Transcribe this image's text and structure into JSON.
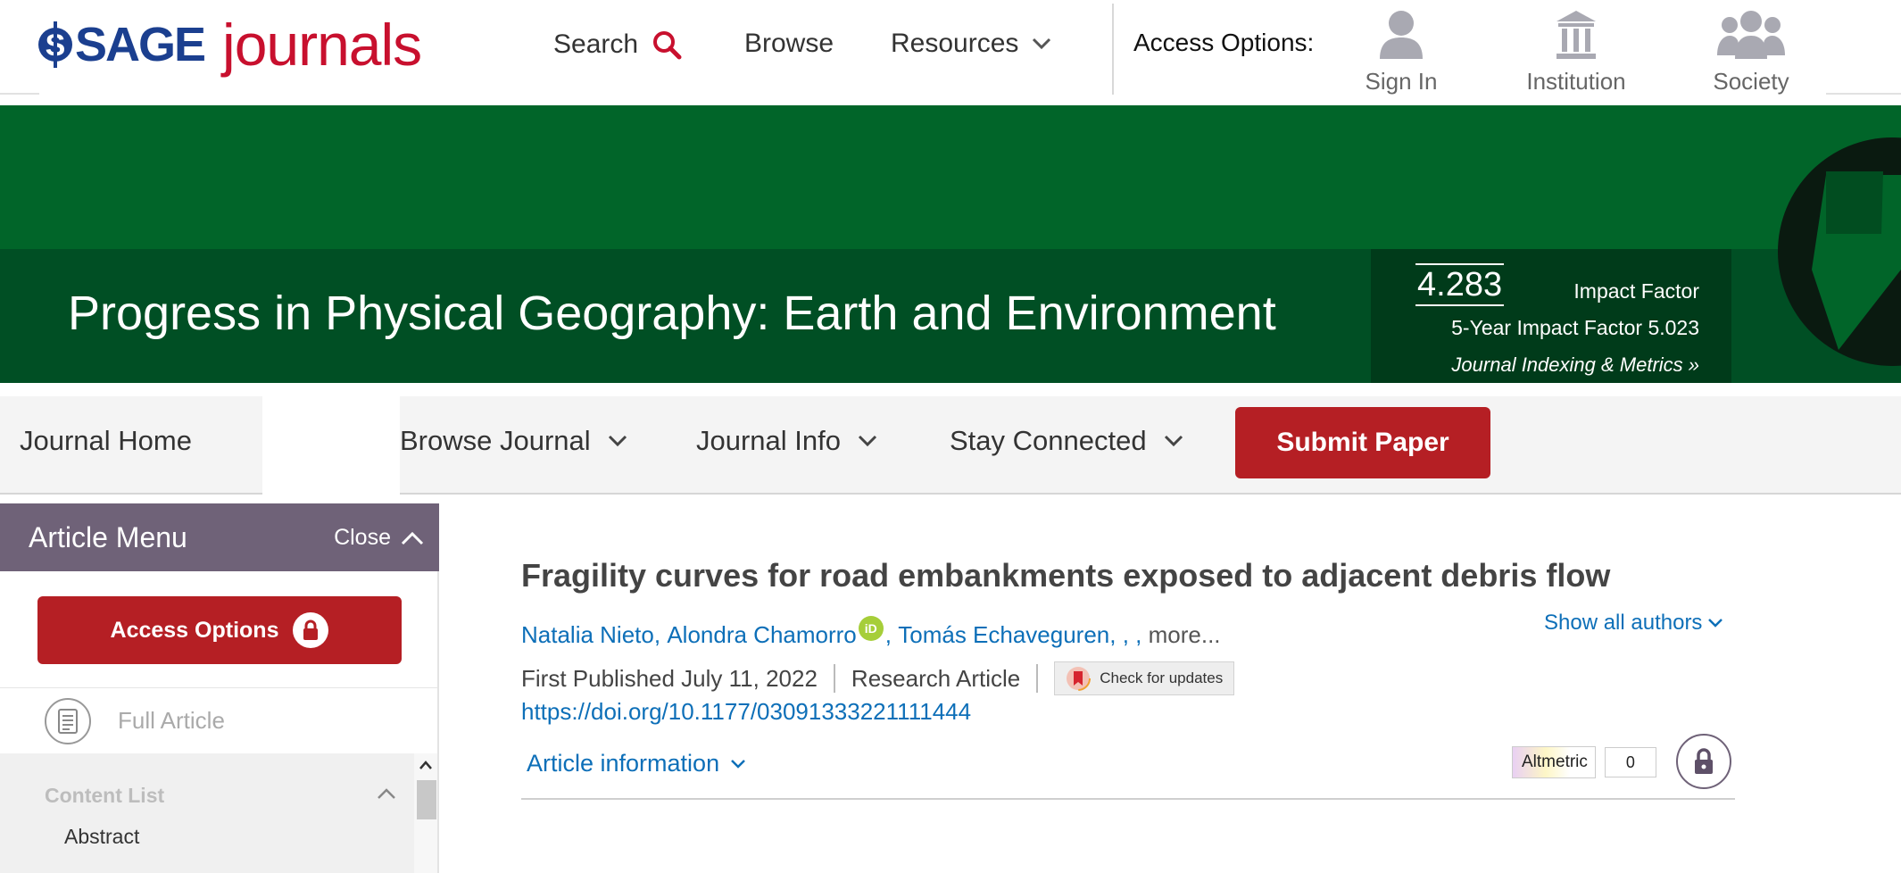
{
  "header": {
    "logo_sage": "SAGE",
    "logo_journals": "journals",
    "nav": {
      "search": "Search",
      "browse": "Browse",
      "resources": "Resources"
    },
    "access_label": "Access Options:",
    "access": {
      "sign_in": "Sign In",
      "institution": "Institution",
      "society": "Society"
    }
  },
  "banner": {
    "journal_title": "Progress in Physical Geography: Earth and Environment",
    "impact_factor": "4.283",
    "impact_label": "Impact Factor",
    "five_year": "5-Year Impact Factor 5.023",
    "indexing_link": "Journal Indexing & Metrics »"
  },
  "journal_nav": {
    "home": "Journal Home",
    "browse": "Browse Journal",
    "info": "Journal Info",
    "stay": "Stay Connected",
    "submit": "Submit Paper"
  },
  "article_menu": {
    "title": "Article Menu",
    "close": "Close",
    "access_button": "Access Options",
    "full_article": "Full Article",
    "content_list": "Content List",
    "items": [
      "Abstract"
    ]
  },
  "article": {
    "title": "Fragility curves for road embankments exposed to adjacent debris flow",
    "authors": [
      "Natalia Nieto",
      "Alondra Chamorro",
      "Tomás Echaveguren"
    ],
    "separators": {
      "comma": ",",
      "trail": ", , ,"
    },
    "more": "more...",
    "orcid_label": "iD",
    "show_all_authors": "Show all authors",
    "first_published": "First Published July 11, 2022",
    "article_type": "Research Article",
    "check_updates": "Check for updates",
    "doi": "https://doi.org/10.1177/03091333221111444",
    "article_information": "Article information",
    "altmetric_label": "Altmetric",
    "altmetric_count": "0"
  },
  "colors": {
    "sage_blue": "#1b3f8f",
    "journals_red": "#c8102e",
    "banner_green": "#016529",
    "banner_dark_green": "#004f24",
    "metrics_box": "#003b1a",
    "submit_red": "#b51f24",
    "article_menu_purple": "#6f6278",
    "link_blue": "#0d6fb8"
  },
  "icons": [
    "search-icon",
    "chevron-down-icon",
    "user-icon",
    "institution-icon",
    "society-icon",
    "chevron-up-icon",
    "lock-icon",
    "document-icon",
    "orcid-icon",
    "crossmark-icon"
  ]
}
